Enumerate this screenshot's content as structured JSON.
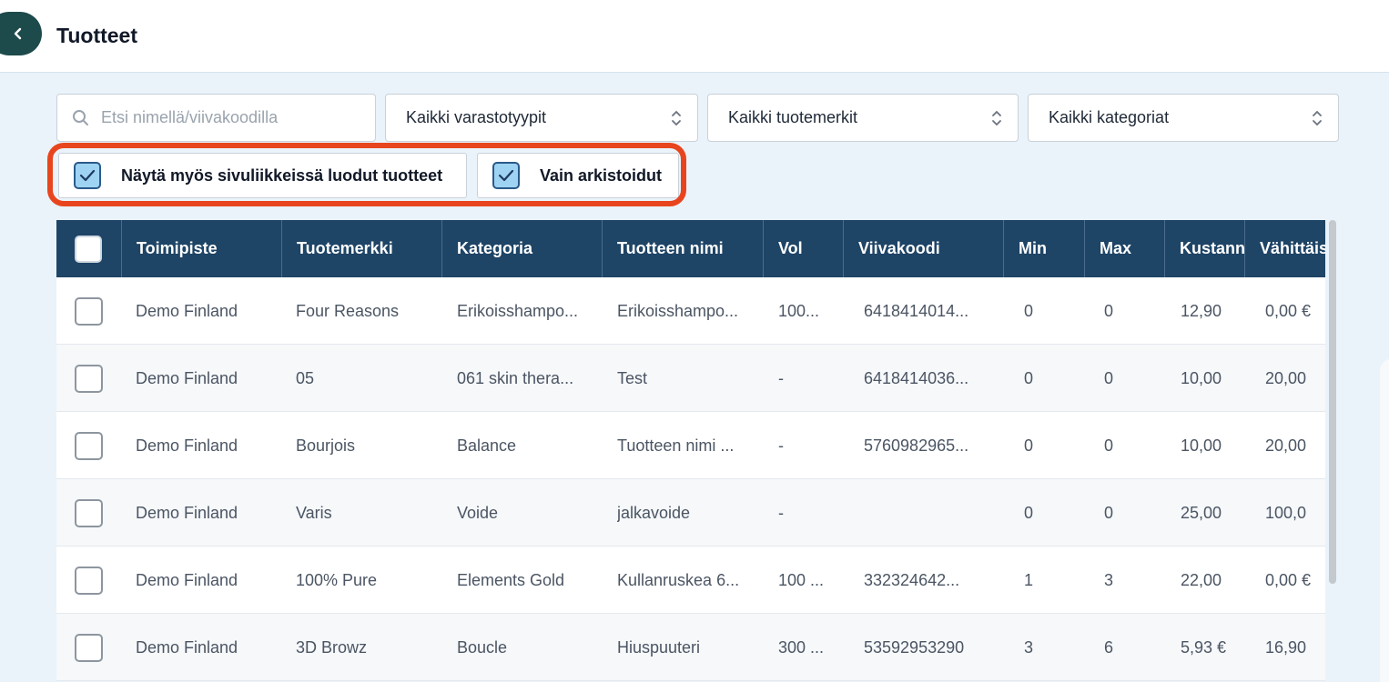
{
  "header": {
    "title": "Tuotteet"
  },
  "filters": {
    "search_placeholder": "Etsi nimellä/viivakoodilla",
    "warehouse_type": "Kaikki varastotyypit",
    "brand": "Kaikki tuotemerkit",
    "category": "Kaikki kategoriat"
  },
  "toggles": {
    "show_branch_label": "Näytä myös sivuliikkeissä luodut tuotteet",
    "archived_label": "Vain arkistoidut",
    "highlight_color": "#e8451e"
  },
  "table": {
    "columns": [
      "Toimipiste",
      "Tuotemerkki",
      "Kategoria",
      "Tuotteen nimi",
      "Vol",
      "Viivakoodi",
      "Min",
      "Max",
      "Kustann",
      "Vähittäis"
    ],
    "rows": [
      [
        "Demo Finland",
        "Four Reasons",
        "Erikoisshampo...",
        "Erikoisshampo...",
        "100...",
        "6418414014...",
        "0",
        "0",
        "12,90",
        "0,00 €"
      ],
      [
        "Demo Finland",
        "05",
        "061 skin thera...",
        "Test",
        "-",
        "6418414036...",
        "0",
        "0",
        "10,00",
        "20,00"
      ],
      [
        "Demo Finland",
        "Bourjois",
        "Balance",
        "Tuotteen nimi ...",
        "-",
        "5760982965...",
        "0",
        "0",
        "10,00",
        "20,00"
      ],
      [
        "Demo Finland",
        "Varis",
        "Voide",
        "jalkavoide",
        "-",
        "",
        "0",
        "0",
        "25,00",
        "100,0"
      ],
      [
        "Demo Finland",
        "100% Pure",
        "Elements Gold",
        "Kullanruskea 6...",
        "100 ...",
        "332324642...",
        "1",
        "3",
        "22,00",
        "0,00 €"
      ],
      [
        "Demo Finland",
        "3D Browz",
        "Boucle",
        "Hiuspuuteri",
        "300 ...",
        "53592953290",
        "3",
        "6",
        "5,93 €",
        "16,90"
      ]
    ]
  },
  "colors": {
    "header_bg": "#1e4466",
    "accent": "#1d4a4a",
    "checked_bg": "#9fd3f3"
  }
}
